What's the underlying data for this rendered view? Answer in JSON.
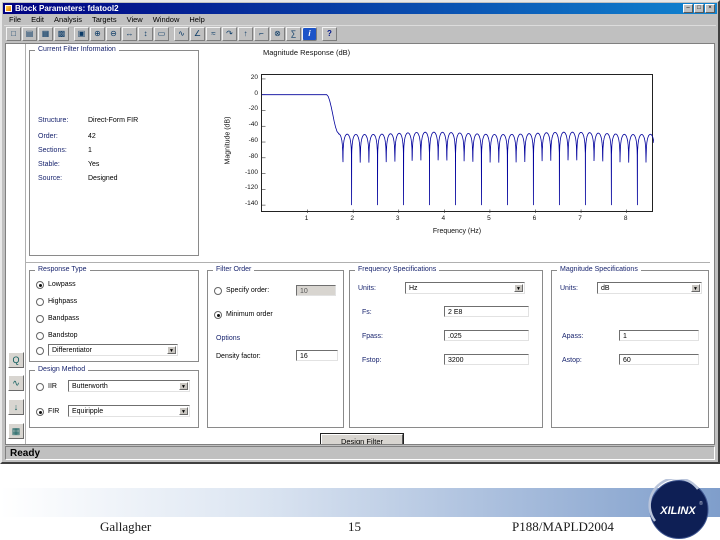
{
  "colors": {
    "titlebar_start": "#000080",
    "titlebar_end": "#1084d0",
    "curve": "#00009c",
    "xilinx_navy": "#0e1f55",
    "band_blue": "#7f9ecb"
  },
  "window": {
    "title": "Block Parameters: fdatool2",
    "controls": {
      "minimize": "–",
      "maximize": "□",
      "close": "×"
    },
    "menu": [
      "File",
      "Edit",
      "Analysis",
      "Targets",
      "View",
      "Window",
      "Help"
    ],
    "status": "Ready"
  },
  "toolbar": {
    "icons": [
      {
        "name": "new-file",
        "glyph": "□"
      },
      {
        "name": "open-file",
        "glyph": "▤"
      },
      {
        "name": "save",
        "glyph": "▦"
      },
      {
        "name": "print",
        "glyph": "▩"
      },
      {
        "name": "copy",
        "glyph": "▣"
      },
      {
        "name": "zoom-in",
        "glyph": "⊕"
      },
      {
        "name": "zoom-out",
        "glyph": "⊖"
      },
      {
        "name": "zoom-x",
        "glyph": "↔"
      },
      {
        "name": "zoom-y",
        "glyph": "↕"
      },
      {
        "name": "full-view",
        "glyph": "▭"
      },
      {
        "name": "magnitude-response",
        "glyph": "∿"
      },
      {
        "name": "phase-response",
        "glyph": "∠"
      },
      {
        "name": "magnitude-phase",
        "glyph": "≈"
      },
      {
        "name": "group-delay",
        "glyph": "↷"
      },
      {
        "name": "impulse-response",
        "glyph": "↑"
      },
      {
        "name": "step-response",
        "glyph": "⌐"
      },
      {
        "name": "pole-zero-plot",
        "glyph": "⊗"
      },
      {
        "name": "coefficients",
        "glyph": "∑"
      },
      {
        "name": "filter-info",
        "glyph": "i"
      },
      {
        "name": "help",
        "glyph": "?"
      }
    ]
  },
  "sidebar": {
    "icons": [
      {
        "name": "set-quantization",
        "glyph": "Q"
      },
      {
        "name": "design-filter",
        "glyph": "∿"
      },
      {
        "name": "import-filter",
        "glyph": "↓"
      },
      {
        "name": "realize-model",
        "glyph": "▦"
      }
    ]
  },
  "filter_info": {
    "title": "Current Filter Information",
    "fields": [
      {
        "label": "Structure:",
        "value": "Direct-Form FIR"
      },
      {
        "label": "Order:",
        "value": "42"
      },
      {
        "label": "Sections:",
        "value": "1"
      },
      {
        "label": "Stable:",
        "value": "Yes"
      },
      {
        "label": "Source:",
        "value": "Designed"
      }
    ]
  },
  "chart_data": {
    "type": "line",
    "title": "Magnitude Response (dB)",
    "xlabel": "Frequency (Hz)",
    "ylabel": "Magnitude (dB)",
    "xlim": [
      0,
      8.6
    ],
    "ylim": [
      -150,
      25
    ],
    "xticks": [
      1,
      2,
      3,
      4,
      5,
      6,
      7,
      8
    ],
    "yticks": [
      20,
      0,
      -20,
      -40,
      -60,
      -80,
      -100,
      -120,
      -140
    ],
    "grid": false,
    "legend": null,
    "series": [
      {
        "name": "Designed FIR equiripple lowpass response",
        "passband_level_db": 0,
        "passband_edge_x": 1.42,
        "stopband_start_x": 1.68,
        "stopband_envelope_db": -49,
        "lobe_spacing_x": 0.19,
        "null_floor_db": -140
      }
    ]
  },
  "response_type": {
    "title": "Response Type",
    "options": [
      {
        "label": "Lowpass",
        "selected": true
      },
      {
        "label": "Highpass",
        "selected": false
      },
      {
        "label": "Bandpass",
        "selected": false
      },
      {
        "label": "Bandstop",
        "selected": false
      }
    ],
    "special_value": "Differentiator"
  },
  "design_method": {
    "title": "Design Method",
    "iir_label": "IIR",
    "iir_value": "Butterworth",
    "fir_label": "FIR",
    "fir_value": "Equiripple"
  },
  "filter_order": {
    "title": "Filter Order",
    "specify_label": "Specify order:",
    "specify_value": "10",
    "minimum_label": "Minimum order",
    "options_label": "Options",
    "density_label": "Density factor:",
    "density_value": "16"
  },
  "frequency_specs": {
    "title": "Frequency Specifications",
    "units_label": "Units:",
    "units_value": "Hz",
    "fields": [
      {
        "label": "Fs:",
        "value": "2 E8"
      },
      {
        "label": "Fpass:",
        "value": ".025"
      },
      {
        "label": "Fstop:",
        "value": "3200"
      }
    ]
  },
  "magnitude_specs": {
    "title": "Magnitude Specifications",
    "units_label": "Units:",
    "units_value": "dB",
    "fields": [
      {
        "label": "Apass:",
        "value": "1"
      },
      {
        "label": "Astop:",
        "value": "60"
      }
    ]
  },
  "design_button": {
    "label": "Design Filter"
  },
  "slide": {
    "author": "Gallagher",
    "page": "15",
    "reference": "P188/MAPLD2004",
    "logo_text": "XILINX",
    "logo_mark": "®"
  }
}
